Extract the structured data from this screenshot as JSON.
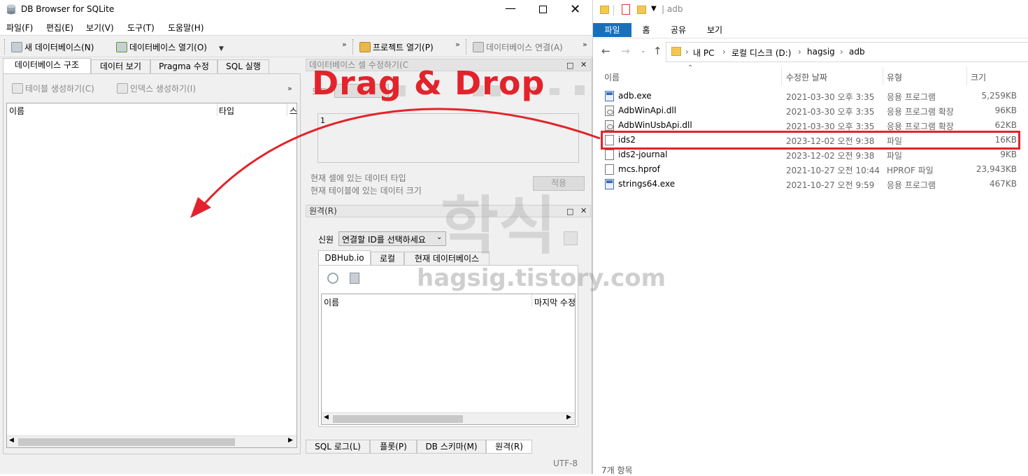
{
  "db": {
    "title": "DB Browser for SQLite",
    "menu": [
      "파일(F)",
      "편집(E)",
      "보기(V)",
      "도구(T)",
      "도움말(H)"
    ],
    "toolbar": {
      "new_db": "새 데이터베이스(N)",
      "open_db": "데이터베이스 열기(O)",
      "open_project": "프로젝트 열기(P)",
      "attach_db": "데이터베이스 연결(A)",
      "more": "»"
    },
    "tabs": [
      "데이터베이스 구조",
      "데이터 보기",
      "Pragma 수정",
      "SQL 실행"
    ],
    "structure": {
      "create_table": "테이블 생성하기(C)",
      "create_index": "인덱스 생성하기(I)",
      "col_name": "이름",
      "col_type": "타입",
      "col_schema": "스"
    },
    "edit_cell": {
      "title": "데이터베이스 셀 수정하기(C",
      "mode_label": "모드",
      "value": "1",
      "type_info": "현재 셀에 있는 데이터 타입",
      "size_info": "현재 테이블에 있는 데이터 크기",
      "apply": "적용"
    },
    "remote": {
      "title": "원격(R)",
      "identity_label": "신원",
      "identity_select": "연결할 ID를 선택하세요",
      "tabs": [
        "DBHub.io",
        "로컬",
        "현재 데이터베이스"
      ],
      "col_name": "이름",
      "col_modified": "마지막 수정"
    },
    "bottom_tabs": [
      "SQL 로그(L)",
      "플롯(P)",
      "DB 스키마(M)",
      "원격(R)"
    ],
    "status_encoding": "UTF-8"
  },
  "explorer": {
    "title": "adb",
    "ribbon_tabs": [
      "파일",
      "홈",
      "공유",
      "보기"
    ],
    "breadcrumb": [
      "내 PC",
      "로컬 디스크 (D:)",
      "hagsig",
      "adb"
    ],
    "columns": [
      "이름",
      "수정한 날짜",
      "유형",
      "크기"
    ],
    "files": [
      {
        "name": "adb.exe",
        "date": "2021-03-30 오후 3:35",
        "type": "응용 프로그램",
        "size": "5,259KB",
        "icon": "exe-icon"
      },
      {
        "name": "AdbWinApi.dll",
        "date": "2021-03-30 오후 3:35",
        "type": "응용 프로그램 확장",
        "size": "96KB",
        "icon": "dll-icon"
      },
      {
        "name": "AdbWinUsbApi.dll",
        "date": "2021-03-30 오후 3:35",
        "type": "응용 프로그램 확장",
        "size": "62KB",
        "icon": "dll-icon"
      },
      {
        "name": "ids2",
        "date": "2023-12-02 오전 9:38",
        "type": "파일",
        "size": "16KB",
        "icon": "file-icon"
      },
      {
        "name": "ids2-journal",
        "date": "2023-12-02 오전 9:38",
        "type": "파일",
        "size": "9KB",
        "icon": "file-icon"
      },
      {
        "name": "mcs.hprof",
        "date": "2021-10-27 오전 10:44",
        "type": "HPROF 파일",
        "size": "23,943KB",
        "icon": "file-icon"
      },
      {
        "name": "strings64.exe",
        "date": "2021-10-27 오전 9:59",
        "type": "응용 프로그램",
        "size": "467KB",
        "icon": "exe-icon"
      }
    ],
    "status": "7개 항목"
  },
  "overlay": {
    "drag_drop": "Drag & Drop",
    "watermark_big": "학식",
    "watermark_url": "hagsig.tistory.com",
    "accent": "#e3232b"
  }
}
